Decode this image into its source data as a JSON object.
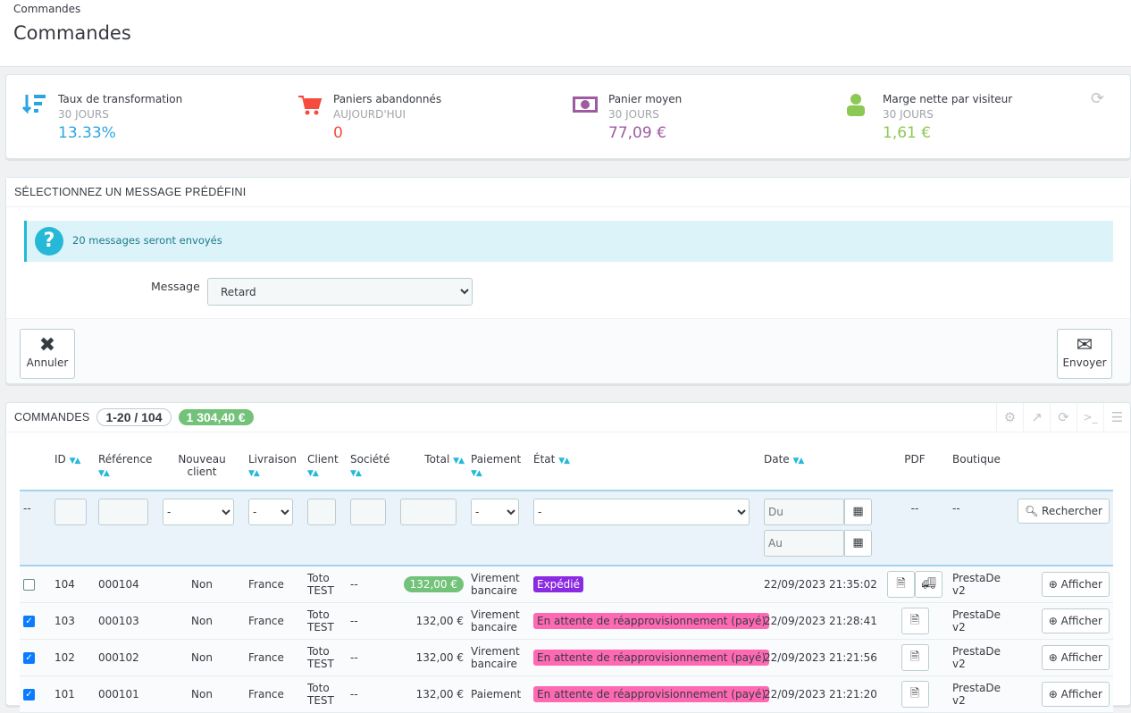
{
  "header": {
    "breadcrumb": "Commandes",
    "title": "Commandes"
  },
  "kpis": [
    {
      "label": "Taux de transformation",
      "sub": "30 JOURS",
      "value": "13.33%",
      "icon": "sort-amount-down-icon",
      "color": "#2ba5e2"
    },
    {
      "label": "Paniers abandonnés",
      "sub": "AUJOURD'HUI",
      "value": "0",
      "icon": "cart-icon",
      "color": "#f54c3e"
    },
    {
      "label": "Panier moyen",
      "sub": "30 JOURS",
      "value": "77,09 €",
      "icon": "banknote-icon",
      "color": "#9e5ba1"
    },
    {
      "label": "Marge nette par visiteur",
      "sub": "30 JOURS",
      "value": "1,61 €",
      "icon": "user-icon",
      "color": "#8bc954"
    }
  ],
  "message_panel": {
    "title": "Sélectionnez un message prédéfini",
    "alert": "20 messages seront envoyés",
    "message_label": "Message",
    "message_value": "Retard",
    "cancel": "Annuler",
    "send": "Envoyer"
  },
  "orders": {
    "title": "Commandes",
    "range": "1-20 / 104",
    "total": "1 304,40 €",
    "columns": {
      "id": "ID",
      "reference": "Référence",
      "new_client": "Nouveau client",
      "delivery": "Livraison",
      "client": "Client",
      "company": "Société",
      "total": "Total",
      "payment": "Paiement",
      "state": "État",
      "date": "Date",
      "pdf": "PDF",
      "shop": "Boutique"
    },
    "filters": {
      "dash": "--",
      "select_dash": "-",
      "date_from": "Du",
      "date_to": "Au",
      "pdf": "--",
      "shop": "--",
      "search": "Rechercher"
    },
    "rows": [
      {
        "checked": false,
        "id": "104",
        "ref": "000104",
        "new": "Non",
        "country": "France",
        "client": "Toto TEST",
        "company": "--",
        "total": "132,00 €",
        "payment": "Virement bancaire",
        "state": "Expédié",
        "state_color": "#8a2be2",
        "date": "22/09/2023 21:35:02",
        "shop": "PrestaDe v2",
        "action": "Afficher"
      },
      {
        "checked": true,
        "id": "103",
        "ref": "000103",
        "new": "Non",
        "country": "France",
        "client": "Toto TEST",
        "company": "--",
        "total": "132,00 €",
        "payment": "Virement bancaire",
        "state": "En attente de réapprovisionnement (payé)",
        "state_color": "#ff69b4",
        "date": "22/09/2023 21:28:41",
        "shop": "PrestaDe v2",
        "action": "Afficher"
      },
      {
        "checked": true,
        "id": "102",
        "ref": "000102",
        "new": "Non",
        "country": "France",
        "client": "Toto TEST",
        "company": "--",
        "total": "132,00 €",
        "payment": "Virement bancaire",
        "state": "En attente de réapprovisionnement (payé)",
        "state_color": "#ff69b4",
        "date": "22/09/2023 21:21:56",
        "shop": "PrestaDe v2",
        "action": "Afficher"
      },
      {
        "checked": true,
        "id": "101",
        "ref": "000101",
        "new": "Non",
        "country": "France",
        "client": "Toto TEST",
        "company": "--",
        "total": "132,00 €",
        "payment": "Paiement",
        "state": "En attente de réapprovisionnement (payé)",
        "state_color": "#ff69b4",
        "date": "22/09/2023 21:21:20",
        "shop": "PrestaDe v2",
        "action": "Afficher"
      }
    ]
  }
}
